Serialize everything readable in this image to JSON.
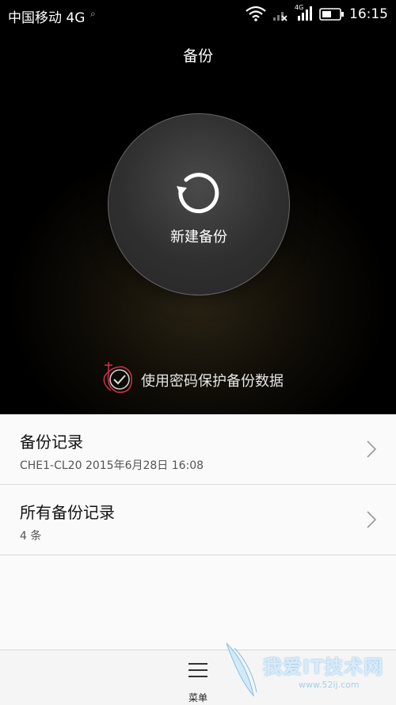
{
  "status_bar": {
    "carrier": "中国移动 4G",
    "network_badge": "4G",
    "time": "16:15"
  },
  "header": {
    "title": "备份"
  },
  "new_backup": {
    "label": "新建备份",
    "icon": "refresh-icon"
  },
  "password_protect": {
    "label": "使用密码保护备份数据",
    "checked": true
  },
  "list": {
    "items": [
      {
        "title": "备份记录",
        "subtitle": "CHE1-CL20  2015年6月28日 16:08"
      },
      {
        "title": "所有备份记录",
        "subtitle": "4 条"
      }
    ]
  },
  "bottom_bar": {
    "menu_label": "菜单"
  },
  "watermark": {
    "text": "我爱IT技术网",
    "url": "www.52ij.com"
  },
  "colors": {
    "accent_annotation": "#d0304a",
    "list_bg": "#fafafa"
  }
}
